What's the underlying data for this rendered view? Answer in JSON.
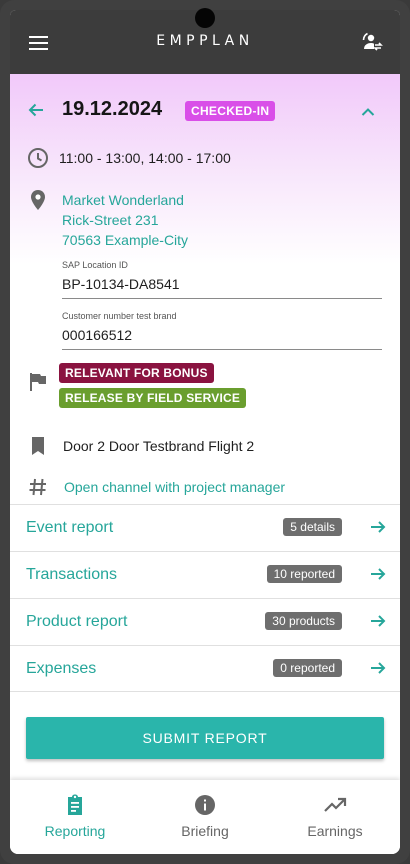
{
  "header": {
    "brand": "EMPPLAN",
    "menu_icon": "hamburger-menu-icon",
    "swap_icon": "switch-account-icon"
  },
  "visit": {
    "date": "19.12.2024",
    "status": "CHECKED-IN",
    "time": "11:00 - 13:00, 14:00 - 17:00",
    "address_line1": "Market Wonderland",
    "address_line2": "Rick-Street 231",
    "address_line3": "70563 Example-City",
    "sap_label": "SAP Location ID",
    "sap_value": "BP-10134-DA8541",
    "customer_label": "Customer number test brand",
    "customer_value": "000166512",
    "badge_bonus": "RELEVANT FOR BONUS",
    "badge_release": "RELEASE BY FIELD SERVICE",
    "project": "Door 2 Door Testbrand Flight 2",
    "channel_link": "Open channel with project manager"
  },
  "reports": [
    {
      "title": "Event report",
      "badge": "5 details"
    },
    {
      "title": "Transactions",
      "badge": "10 reported"
    },
    {
      "title": "Product report",
      "badge": "30 products"
    },
    {
      "title": "Expenses",
      "badge": "0 reported"
    }
  ],
  "submit_label": "SUBMIT REPORT",
  "nav": [
    {
      "label": "Reporting",
      "icon": "clipboard-icon",
      "active": true
    },
    {
      "label": "Briefing",
      "icon": "info-icon",
      "active": false
    },
    {
      "label": "Earnings",
      "icon": "trending-up-icon",
      "active": false
    }
  ],
  "colors": {
    "accent": "#26a69a",
    "status_badge": "#d94fe8",
    "bonus_badge": "#8a1340",
    "release_badge": "#6a9e2e",
    "header": "#3c3c3c"
  }
}
